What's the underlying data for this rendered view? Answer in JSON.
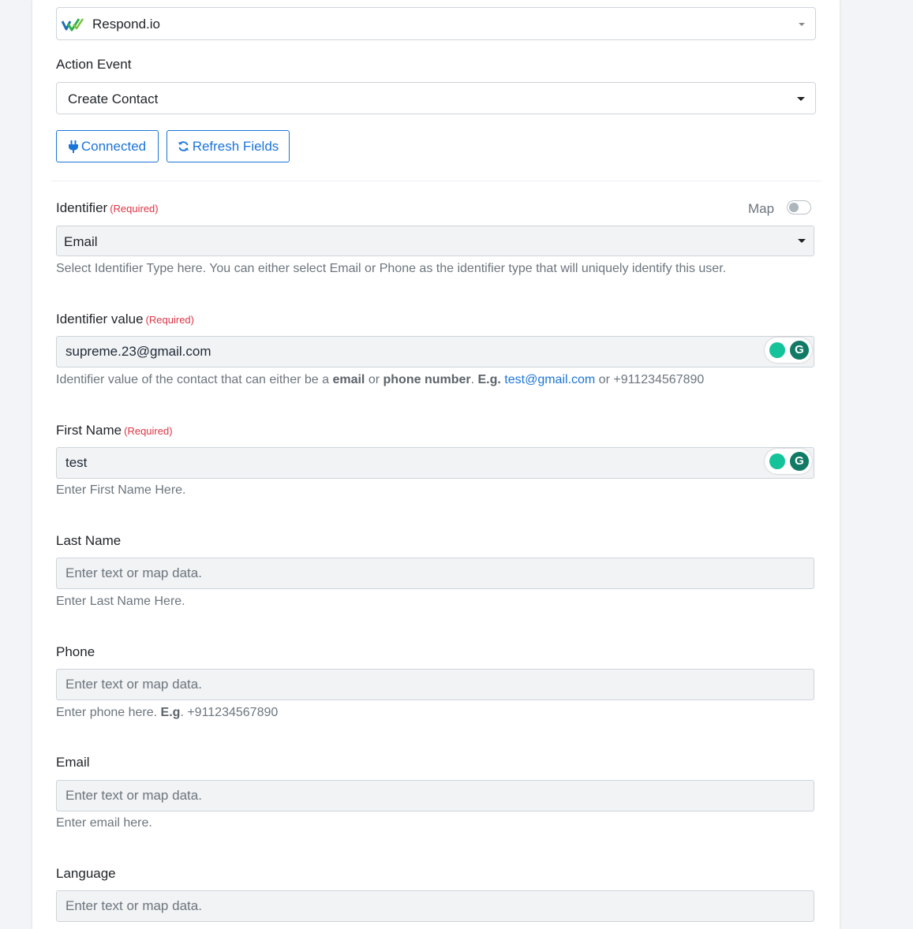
{
  "app_select": {
    "value": "Respond.io"
  },
  "action_event": {
    "label": "Action Event",
    "value": "Create Contact"
  },
  "buttons": {
    "connected": "Connected",
    "refresh": "Refresh Fields"
  },
  "identifier": {
    "label": "Identifier",
    "required": "(Required)",
    "map_label": "Map",
    "value": "Email",
    "help": "Select Identifier Type here. You can either select Email or Phone as the identifier type that will uniquely identify this user."
  },
  "identifier_value": {
    "label": "Identifier value",
    "required": "(Required)",
    "value": "supreme.23@gmail.com",
    "help_1": "Identifier value of the contact that can either be a ",
    "help_b1": "email",
    "help_2": " or ",
    "help_b2": "phone number",
    "help_3": ". ",
    "help_b3": "E.g.",
    "help_link": "test@gmail.com",
    "help_4": " or +911234567890"
  },
  "first_name": {
    "label": "First Name",
    "required": "(Required)",
    "value": "test",
    "help": "Enter First Name Here."
  },
  "last_name": {
    "label": "Last Name",
    "placeholder": "Enter text or map data.",
    "help": "Enter Last Name Here."
  },
  "phone": {
    "label": "Phone",
    "placeholder": "Enter text or map data.",
    "help_1": "Enter phone here. ",
    "help_b": "E.g",
    "help_2": ". +911234567890"
  },
  "email": {
    "label": "Email",
    "placeholder": "Enter text or map data.",
    "help": "Enter email here."
  },
  "language": {
    "label": "Language",
    "placeholder": "Enter text or map data."
  },
  "colors": {
    "primary": "#1b74d8",
    "required": "#dc3545",
    "field_bg": "#f1f3f5"
  }
}
